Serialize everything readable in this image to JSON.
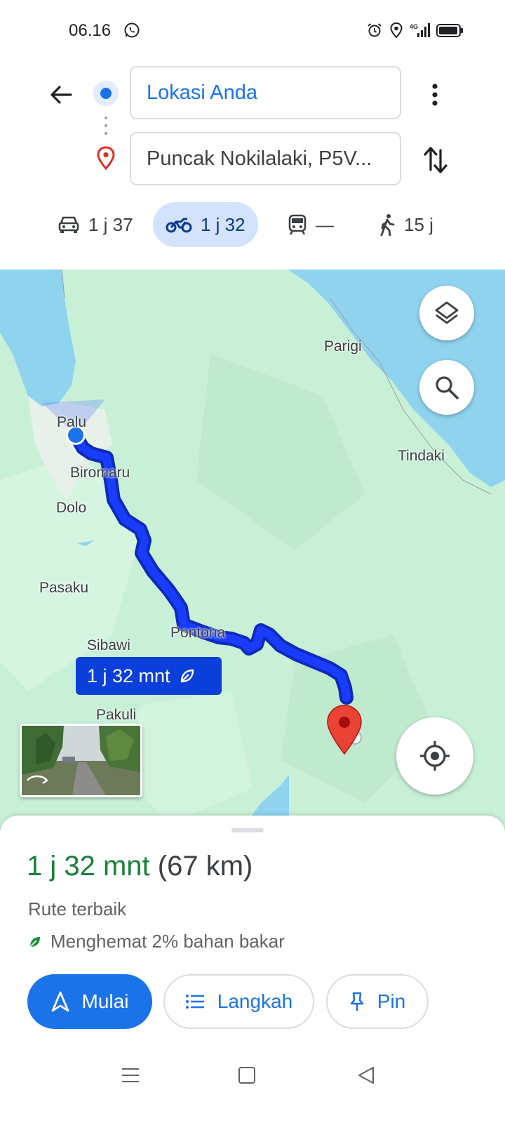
{
  "status_bar": {
    "time": "06.16",
    "network": "4G"
  },
  "directions": {
    "origin": "Lokasi Anda",
    "destination": "Puncak Nokilalaki, P5V..."
  },
  "modes": [
    {
      "name": "car",
      "icon": "car-icon",
      "label": "1 j 37"
    },
    {
      "name": "motorcycle",
      "icon": "motorcycle-icon",
      "label": "1 j 32",
      "selected": true
    },
    {
      "name": "transit",
      "icon": "train-icon",
      "label": "—"
    },
    {
      "name": "walk",
      "icon": "walk-icon",
      "label": "15 j"
    }
  ],
  "map": {
    "places": [
      "Parigi",
      "Palu",
      "Tindaki",
      "Biromaru",
      "Dolo",
      "Pasaku",
      "Pontona",
      "Sibawi",
      "Pakuli"
    ],
    "route_badge": "1 j 32 mnt",
    "colors": {
      "land": "#c8f0d7",
      "water": "#8fd3ee",
      "route": "#1a3cff",
      "route_outline": "#0b2bb8",
      "destination_pin": "#ea4335"
    }
  },
  "summary": {
    "duration": "1 j 32 mnt",
    "distance": "(67 km)",
    "best_route": "Rute terbaik",
    "fuel_saving": "Menghemat 2% bahan bakar"
  },
  "actions": {
    "start": "Mulai",
    "steps": "Langkah",
    "pin": "Pin"
  },
  "accent_color": "#1a73e8",
  "duration_color": "#188038"
}
